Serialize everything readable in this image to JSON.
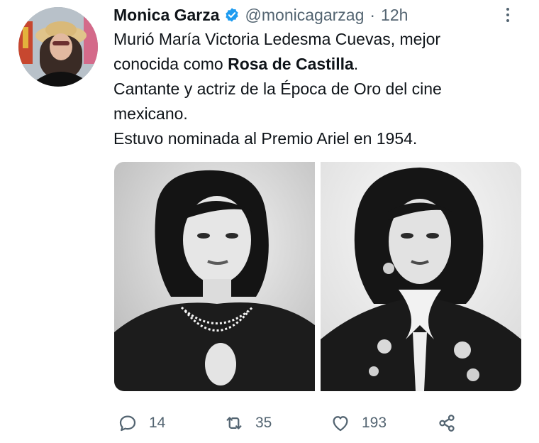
{
  "tweet": {
    "author_name": "Monica Garza",
    "author_handle": "@monicagarzag",
    "separator": "·",
    "time": "12h",
    "lines": [
      {
        "pre": "Murió María Victoria Ledesma Cuevas, mejor",
        "bold": "",
        "post": ""
      },
      {
        "pre": "conocida como ",
        "bold": "Rosa de Castilla",
        "post": "."
      },
      {
        "pre": "Cantante y actriz de la Época de Oro del cine",
        "bold": "",
        "post": ""
      },
      {
        "pre": "mexicano.",
        "bold": "",
        "post": ""
      },
      {
        "pre": "Estuvo nominada al Premio Ariel en 1954.",
        "bold": "",
        "post": ""
      }
    ]
  },
  "actions": {
    "reply_count": "14",
    "retweet_count": "35",
    "like_count": "193"
  },
  "icons": {
    "verified": "verified-badge-icon",
    "more": "more-options-icon",
    "reply": "reply-icon",
    "retweet": "retweet-icon",
    "like": "heart-icon",
    "share": "share-icon"
  },
  "colors": {
    "verified": "#1d9bf0",
    "text": "#0f1419",
    "secondary": "#536471"
  }
}
